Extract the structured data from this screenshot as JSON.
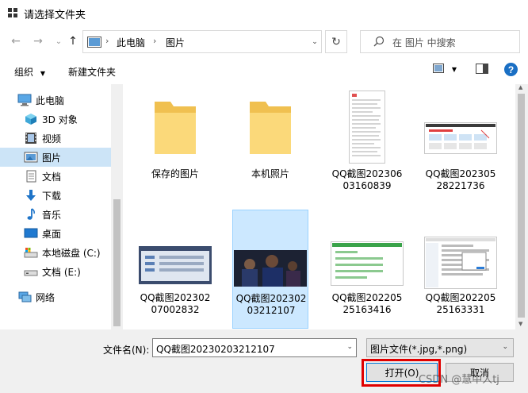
{
  "window": {
    "title": "请选择文件夹"
  },
  "address": {
    "crumbs": [
      "此电脑",
      "图片"
    ]
  },
  "search": {
    "placeholder": "在 图片 中搜索"
  },
  "toolbar": {
    "organize_label": "组织",
    "new_folder_label": "新建文件夹"
  },
  "sidebar": {
    "items": [
      {
        "label": "此电脑",
        "icon": "computer-icon",
        "root": true
      },
      {
        "label": "3D 对象",
        "icon": "3d-objects-icon"
      },
      {
        "label": "视频",
        "icon": "video-icon"
      },
      {
        "label": "图片",
        "icon": "pictures-icon",
        "selected": true
      },
      {
        "label": "文档",
        "icon": "documents-icon"
      },
      {
        "label": "下载",
        "icon": "download-icon"
      },
      {
        "label": "音乐",
        "icon": "music-icon"
      },
      {
        "label": "桌面",
        "icon": "desktop-icon"
      },
      {
        "label": "本地磁盘 (C:)",
        "icon": "local-disk-icon"
      },
      {
        "label": "文档 (E:)",
        "icon": "drive-icon"
      },
      {
        "label": "网络",
        "icon": "network-icon",
        "root": true
      }
    ]
  },
  "files": [
    {
      "label": "保存的图片",
      "kind": "folder"
    },
    {
      "label": "本机照片",
      "kind": "folder"
    },
    {
      "label": "QQ截图20230603160839",
      "kind": "doc"
    },
    {
      "label": "QQ截图20230528221736",
      "kind": "web"
    },
    {
      "label": "QQ截图20230207002832",
      "kind": "app"
    },
    {
      "label": "QQ截图20230203212107",
      "kind": "dark",
      "selected": true
    },
    {
      "label": "QQ截图20220525163416",
      "kind": "form"
    },
    {
      "label": "QQ截图20220525163331",
      "kind": "dialog"
    }
  ],
  "footer": {
    "filename_label": "文件名(N):",
    "filename_value": "QQ截图20230203212107",
    "filetype_value": "图片文件(*.jpg,*.png)",
    "open_label": "打开(O)",
    "cancel_label": "取消",
    "watermark": "CSDN @慧中人tj"
  },
  "colors": {
    "selection": "#cce8ff",
    "accent": "#0078d7",
    "highlight": "#e00000"
  }
}
